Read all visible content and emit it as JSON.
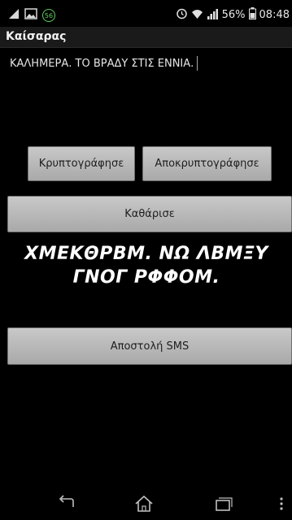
{
  "status_bar": {
    "notification_count": "56",
    "battery_percent": "56%",
    "time": "08:48",
    "icons": [
      "signal-icon-left",
      "image-icon",
      "notification-badge",
      "alarm-icon",
      "wifi-icon",
      "cell-signal-icon",
      "battery-icon"
    ]
  },
  "app": {
    "title": "Καίσαρας"
  },
  "input": {
    "message": "ΚΑΛΗΜΕΡΑ. ΤΟ ΒΡΑΔΥ ΣΤΙΣ ΕΝΝΙΑ."
  },
  "buttons": {
    "encrypt": "Κρυπτογράφησε",
    "decrypt": "Αποκρυπτογράφησε",
    "clear": "Καθάρισε",
    "send_sms": "Αποστολή SMS"
  },
  "result": {
    "line1": "ΧΜΕΚΘΡΒΜ. ΝΩ ΛΒΜΞΥ",
    "line2": "ΓΝΟΓ ΡΦΦΟΜ."
  },
  "nav": {
    "icons": [
      "back-icon",
      "home-icon",
      "recent-apps-icon",
      "menu-icon"
    ]
  },
  "colors": {
    "background": "#000000",
    "button": "#bdbdbd",
    "text": "#ffffff",
    "badge_green": "#5bd15b"
  }
}
